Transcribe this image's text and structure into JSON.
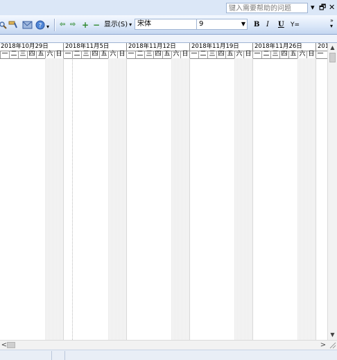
{
  "menubar": {
    "help_placeholder": "键入需要帮助的问题",
    "help_dropdown": "▾",
    "restore_glyph": "🗗",
    "close_glyph": "✕"
  },
  "toolbar": {
    "icons": [
      "search-glyph",
      "paint-glyph",
      "mail-glyph",
      "help-glyph"
    ],
    "nav_left": "⇦",
    "nav_right": "⇨",
    "add": "+",
    "remove": "−",
    "show_label": "显示(S)",
    "show_arrow": "▾",
    "font_name": "宋体",
    "font_size": "9",
    "bold": "B",
    "italic": "I",
    "underline": "U",
    "filter": "Y="
  },
  "chart": {
    "weeks": [
      {
        "label": "2018年10月29日"
      },
      {
        "label": "2018年11月5日"
      },
      {
        "label": "2018年11月12日"
      },
      {
        "label": "2018年11月19日"
      },
      {
        "label": "2018年11月26日"
      },
      {
        "label": "201"
      }
    ],
    "day_labels": [
      "一",
      "二",
      "三",
      "四",
      "五",
      "六",
      "日"
    ],
    "trailing_day": "一"
  },
  "scroll": {
    "up": "▲",
    "down": "▼",
    "left": "<",
    "right": ">"
  }
}
